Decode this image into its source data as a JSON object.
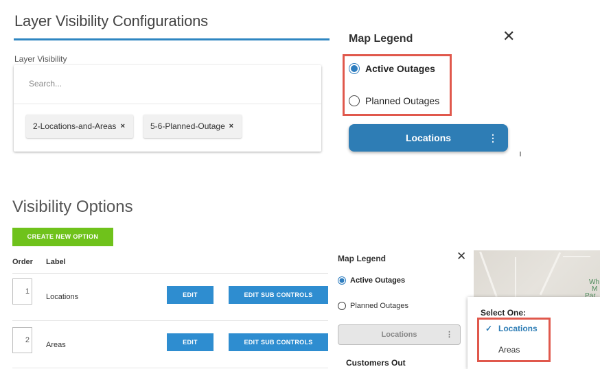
{
  "layer_config": {
    "title": "Layer Visibility Configurations",
    "field_label": "Layer Visibility",
    "search_placeholder": "Search...",
    "chips": [
      {
        "label": "2-Locations-and-Areas",
        "remove": "×"
      },
      {
        "label": "5-6-Planned-Outage",
        "remove": "×"
      }
    ]
  },
  "map_legend_top": {
    "title": "Map Legend",
    "close": "✕",
    "options": [
      {
        "label": "Active Outages",
        "selected": true
      },
      {
        "label": "Planned Outages",
        "selected": false
      }
    ],
    "button_label": "Locations",
    "button_menu": "⋮"
  },
  "visibility_options": {
    "title": "Visibility Options",
    "create_label": "CREATE NEW OPTION",
    "col_order": "Order",
    "col_label": "Label",
    "rows": [
      {
        "order": "1",
        "label": "Locations",
        "edit": "EDIT",
        "edit_sub": "EDIT SUB CONTROLS"
      },
      {
        "order": "2",
        "label": "Areas",
        "edit": "EDIT",
        "edit_sub": "EDIT SUB CONTROLS"
      }
    ]
  },
  "map_legend_bottom": {
    "title": "Map Legend",
    "close": "✕",
    "options": [
      {
        "label": "Active Outages",
        "selected": true
      },
      {
        "label": "Planned Outages",
        "selected": false
      }
    ],
    "button_label": "Locations",
    "button_menu": "⋮",
    "section_label": "Customers Out",
    "map_text_1": "Wh",
    "map_text_2": "M",
    "map_text_3": "Par",
    "dropdown": {
      "heading": "Select One:",
      "check": "✓",
      "options": [
        "Locations",
        "Areas"
      ],
      "selected": "Locations"
    }
  },
  "colors": {
    "accent_blue": "#2e7db5",
    "create_green": "#6fc21b",
    "highlight_red": "#e0584c"
  }
}
